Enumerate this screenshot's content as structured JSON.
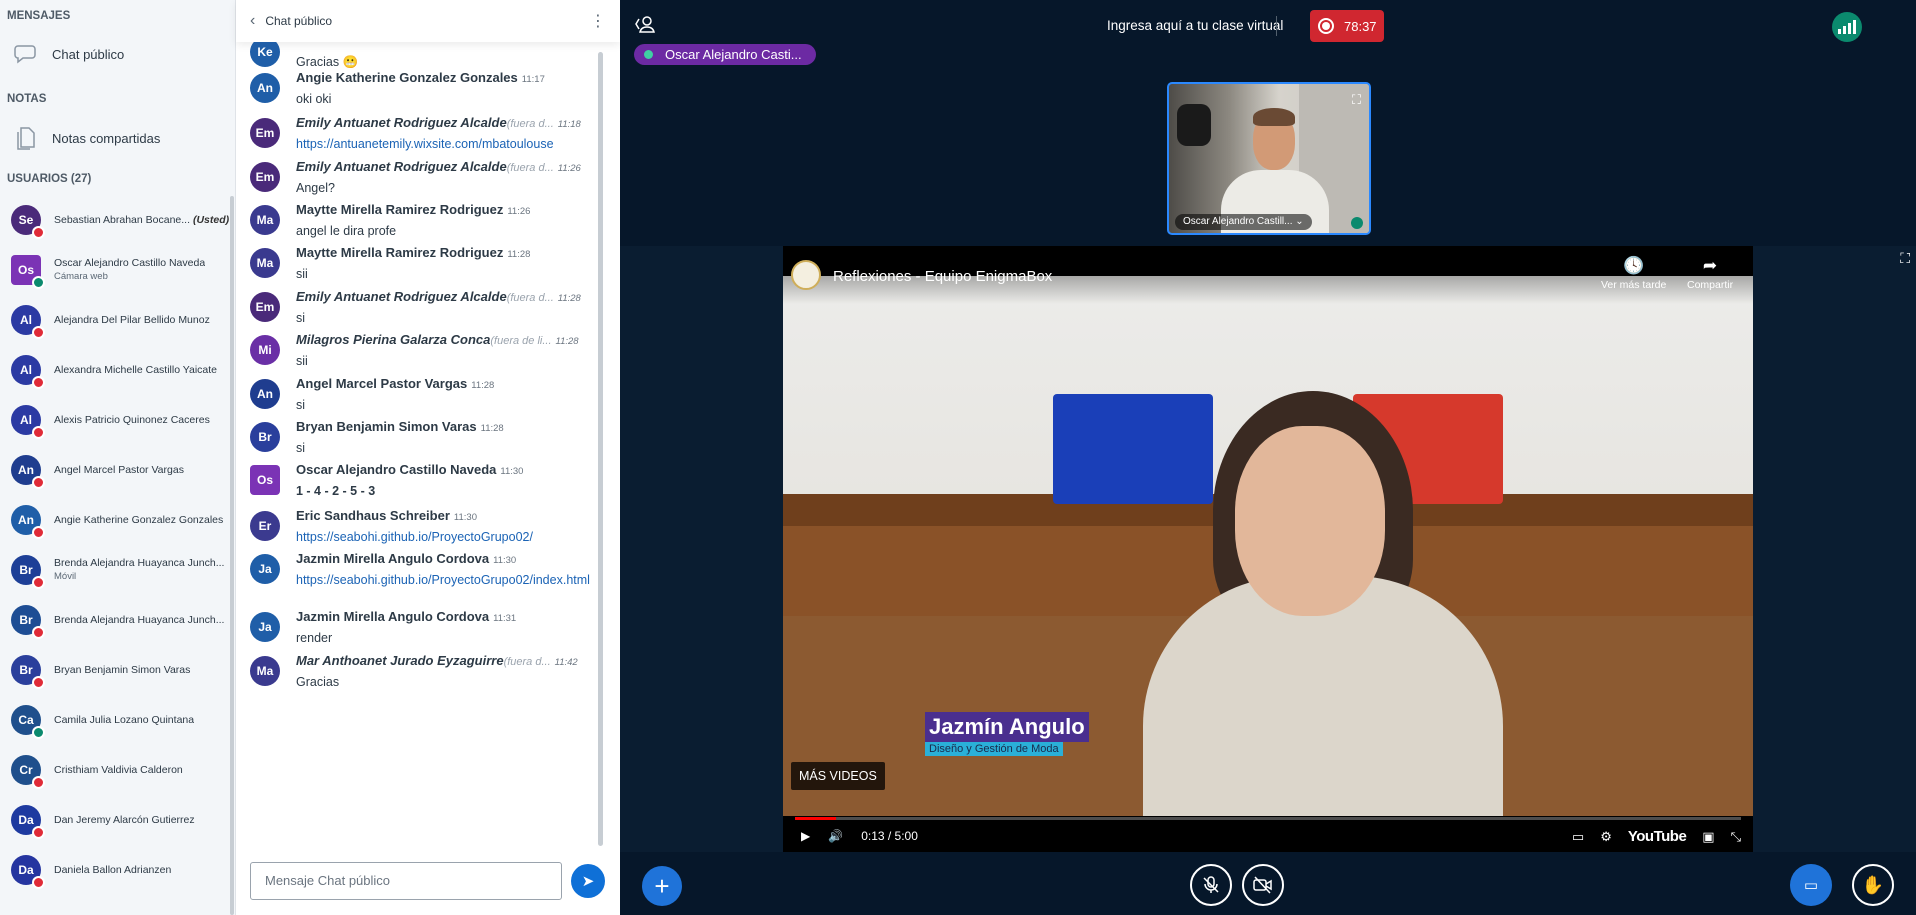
{
  "sidebar": {
    "messages_header": "MENSAJES",
    "public_chat": "Chat público",
    "notes_header": "NOTAS",
    "shared_notes": "Notas compartidas",
    "users_header": "USUARIOS (27)",
    "users": [
      {
        "initials": "Se",
        "name": "Sebastian Abrahan Bocane...",
        "you": "(Usted)",
        "color": "#4a2a7a"
      },
      {
        "initials": "Os",
        "name": "Oscar Alejandro Castillo Naveda",
        "sub": "Cámara web",
        "color": "#7b33b5"
      },
      {
        "initials": "Al",
        "name": "Alejandra Del Pilar Bellido Munoz",
        "color": "#2b3aa3"
      },
      {
        "initials": "Al",
        "name": "Alexandra Michelle Castillo Yaicate",
        "color": "#2b3aa3"
      },
      {
        "initials": "Al",
        "name": "Alexis Patricio Quinonez Caceres",
        "color": "#2b3aa3"
      },
      {
        "initials": "An",
        "name": "Angel Marcel Pastor Vargas",
        "color": "#1f3d8f"
      },
      {
        "initials": "An",
        "name": "Angie Katherine Gonzalez Gonzales",
        "color": "#1f5ea8"
      },
      {
        "initials": "Br",
        "name": "Brenda Alejandra Huayanca Junch...",
        "sub": "Móvil",
        "color": "#1d3f97"
      },
      {
        "initials": "Br",
        "name": "Brenda Alejandra Huayanca Junch...",
        "color": "#1d4d94"
      },
      {
        "initials": "Br",
        "name": "Bryan Benjamin Simon Varas",
        "color": "#2a3f9c"
      },
      {
        "initials": "Ca",
        "name": "Camila Julia Lozano Quintana",
        "color": "#1f4f8c"
      },
      {
        "initials": "Cr",
        "name": "Cristhiam Valdivia Calderon",
        "color": "#1f4f8c"
      },
      {
        "initials": "Da",
        "name": "Dan Jeremy Alarcón Gutierrez",
        "color": "#1e3aa0"
      },
      {
        "initials": "Da",
        "name": "Daniela Ballon Adrianzen",
        "color": "#2535a0"
      }
    ]
  },
  "chat": {
    "title": "Chat público",
    "compose_placeholder": "Mensaje Chat público",
    "messages": [
      {
        "initials": "Ke",
        "color": "#1f5ea8",
        "name": "",
        "time": "",
        "text": "Gracias 😬"
      },
      {
        "initials": "An",
        "color": "#1f5ea8",
        "name": "Angie Katherine Gonzalez Gonzales",
        "time": "11:17",
        "text": "oki oki"
      },
      {
        "initials": "Em",
        "color": "#4a2a7a",
        "name": "Emily Antuanet Rodriguez Alcalde",
        "away": "(fuera d...",
        "time": "11:18",
        "text": "https://antuanetemily.wixsite.com/mbatoulouse",
        "link": true
      },
      {
        "initials": "Em",
        "color": "#4a2a7a",
        "name": "Emily Antuanet Rodriguez Alcalde",
        "away": "(fuera d...",
        "time": "11:26",
        "text": "Angel?"
      },
      {
        "initials": "Ma",
        "color": "#3a3a8f",
        "name": "Maytte Mirella Ramirez Rodriguez",
        "time": "11:26",
        "text": "angel le dira profe"
      },
      {
        "initials": "Ma",
        "color": "#3a3a8f",
        "name": "Maytte Mirella Ramirez Rodriguez",
        "time": "11:28",
        "text": "sii"
      },
      {
        "initials": "Em",
        "color": "#4a2a7a",
        "name": "Emily Antuanet Rodriguez Alcalde",
        "away": "(fuera d...",
        "time": "11:28",
        "text": "si"
      },
      {
        "initials": "Mi",
        "color": "#6a2fa6",
        "name": "Milagros Pierina Galarza Conca",
        "away": "(fuera de li...",
        "time": "11:28",
        "text": "sii"
      },
      {
        "initials": "An",
        "color": "#1f3d8f",
        "name": "Angel Marcel Pastor Vargas",
        "time": "11:28",
        "text": "si"
      },
      {
        "initials": "Br",
        "color": "#2a3f9c",
        "name": "Bryan Benjamin Simon Varas",
        "time": "11:28",
        "text": "si"
      },
      {
        "initials": "Os",
        "color": "#7b33b5",
        "name": "Oscar Alejandro Castillo Naveda",
        "time": "11:30",
        "text": "1 - 4 - 2 - 5 - 3",
        "bold": true
      },
      {
        "initials": "Er",
        "color": "#3b3a8f",
        "name": "Eric Sandhaus Schreiber",
        "time": "11:30",
        "text": "https://seabohi.github.io/ProyectoGrupo02/",
        "link": true
      },
      {
        "initials": "Ja",
        "color": "#1f5ea8",
        "name": "Jazmin Mirella Angulo Cordova",
        "time": "11:30",
        "text": "https://seabohi.github.io/ProyectoGrupo02/index.html",
        "link": true
      },
      {
        "initials": "Ja",
        "color": "#1f5ea8",
        "name": "Jazmin Mirella Angulo Cordova",
        "time": "11:31",
        "text": "render"
      },
      {
        "initials": "Ma",
        "color": "#3a3a8f",
        "name": "Mar Anthoanet Jurado Eyzaguirre",
        "away": "(fuera d...",
        "time": "11:42",
        "text": "Gracias"
      }
    ]
  },
  "main": {
    "title": "Ingresa aquí a tu clase virtual",
    "rec_time": "78:37",
    "talker": "Oscar Alejandro Casti...",
    "webcam_label": "Oscar Alejandro Castill...",
    "video": {
      "title": "Reflexiones - Equipo EnigmaBox",
      "watch_later": "Ver más tarde",
      "share": "Compartir",
      "lower_name": "Jazmín Angulo",
      "lower_sub": "Diseño y Gestión de Moda",
      "more_videos": "MÁS VIDEOS",
      "time": "0:13 / 5:00",
      "progress": 0.043,
      "brand": "YouTube"
    }
  }
}
